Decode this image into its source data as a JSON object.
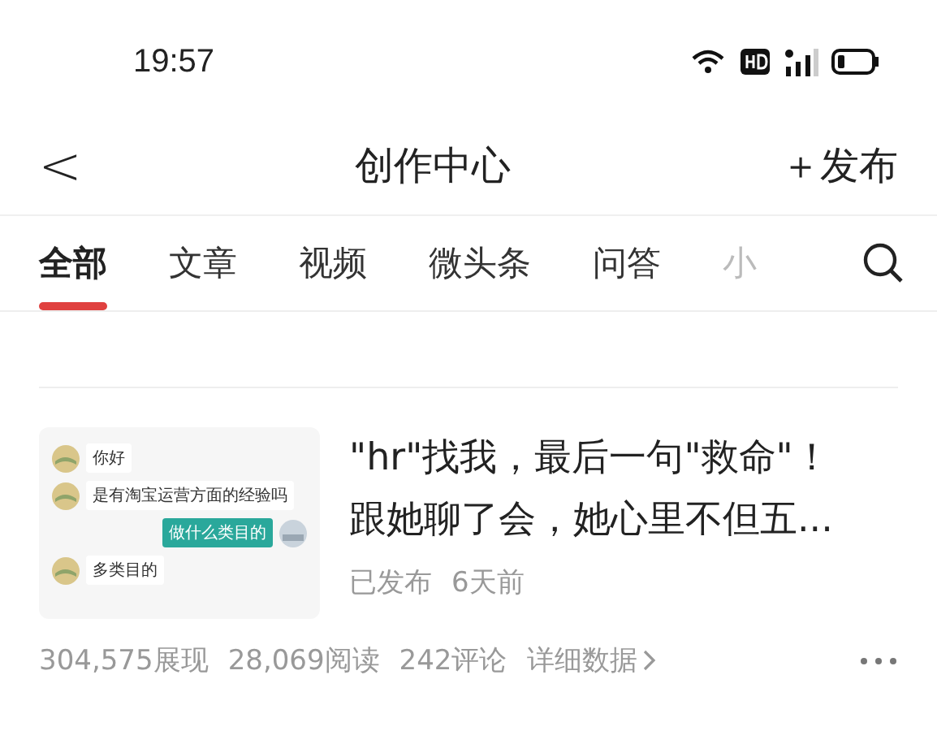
{
  "status_bar": {
    "time": "19:57"
  },
  "header": {
    "back": "<",
    "title": "创作中心",
    "publish": "＋发布"
  },
  "tabs": [
    {
      "label": "全部",
      "selected": true
    },
    {
      "label": "文章",
      "selected": false
    },
    {
      "label": "视频",
      "selected": false
    },
    {
      "label": "微头条",
      "selected": false
    },
    {
      "label": "问答",
      "selected": false
    },
    {
      "label": "小",
      "selected": false
    }
  ],
  "article": {
    "thumbnail": {
      "messages": [
        {
          "text": "你好",
          "kind": "incoming"
        },
        {
          "text": "是有淘宝运营方面的经验吗",
          "kind": "incoming"
        },
        {
          "text": "做什么类目的",
          "kind": "outgoing"
        },
        {
          "text": "多类目的",
          "kind": "incoming"
        }
      ]
    },
    "title_lines": [
      "\"hr\"找我，最后一句\"救命\"！",
      "跟她聊了会，她心里不但五..."
    ],
    "status": "已发布",
    "time": "6天前",
    "stats": [
      "304,575展现",
      "28,069阅读",
      "242评论"
    ],
    "details_link": "详细数据"
  }
}
